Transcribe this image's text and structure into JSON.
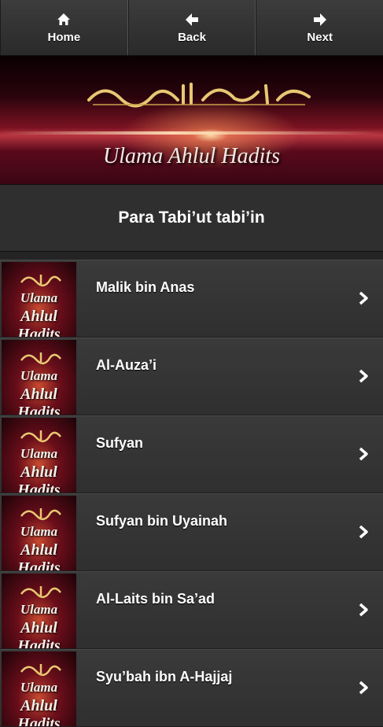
{
  "navbar": {
    "home": {
      "label": "Home",
      "icon": "home-icon"
    },
    "back": {
      "label": "Back",
      "icon": "arrow-left-icon"
    },
    "next": {
      "label": "Next",
      "icon": "arrow-right-icon"
    }
  },
  "banner": {
    "title": "Ulama Ahlul Hadits",
    "calligraphy": "بسم الله الرحمن الرحيم"
  },
  "header": {
    "title": "Para Tabi’ut tabi’in"
  },
  "thumbnail": {
    "line1": "Ulama",
    "line2": "Ahlul Hadits"
  },
  "items": [
    {
      "name": "Malik bin Anas"
    },
    {
      "name": "Al-Auza’i"
    },
    {
      "name": "Sufyan"
    },
    {
      "name": "Sufyan bin Uyainah"
    },
    {
      "name": "Al-Laits bin Sa’ad"
    },
    {
      "name": "Syu’bah ibn A-Hajjaj"
    }
  ],
  "colors": {
    "background": "#2b2b2b",
    "text": "#ffffff",
    "accent": "#7a1222"
  }
}
